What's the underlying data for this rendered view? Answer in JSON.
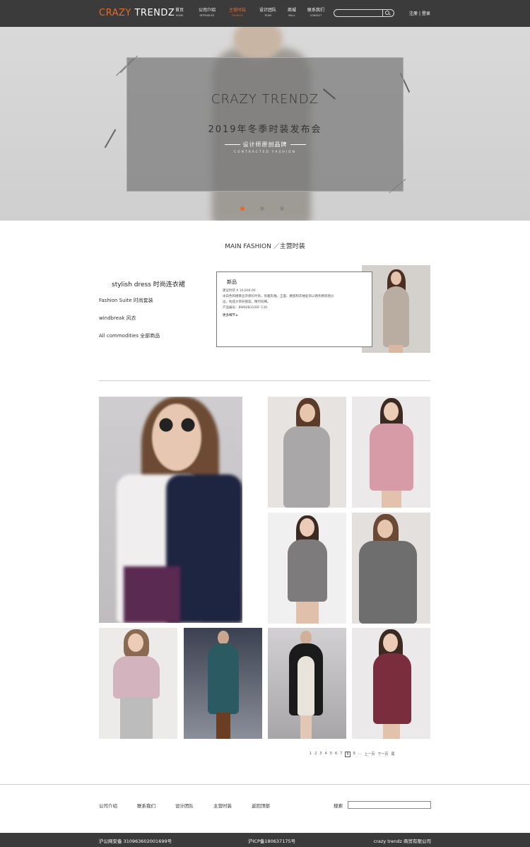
{
  "header": {
    "logo_a": "CRAZY",
    "logo_b": "TRENDZ",
    "nav": [
      {
        "cn": "首页",
        "en": "HOME"
      },
      {
        "cn": "公司介绍",
        "en": "INTRODUCE"
      },
      {
        "cn": "主营时装",
        "en": "FASHION"
      },
      {
        "cn": "设计团队",
        "en": "TEAM"
      },
      {
        "cn": "商城",
        "en": "MALL"
      },
      {
        "cn": "联系我们",
        "en": "CONTACT"
      }
    ],
    "register": "注册",
    "divider": "|",
    "login": "登录",
    "accent": "#e8692a"
  },
  "hero": {
    "title": "CRAZY TRENDZ",
    "subtitle": "2019年冬季时装发布会",
    "tagline": "设计师原创品牌",
    "tagline_en": "CONTRACTED FASHION",
    "active_slide": 1,
    "slides": 3
  },
  "main": {
    "section_title": "MAIN  FASHION ／主营时装",
    "cat_main": "stylish dress  时尚连衣裙",
    "cats": [
      "Fashion Suite   时尚套装",
      "windbreak  风衣",
      "All commodities   全部商品"
    ],
    "product": {
      "title": "新品",
      "price": "建议时装    ¥ 10,500.00",
      "desc1": "米白色和撞黄丝开襟衫时尚，优雅乳釉。正面、腰部和衣袖处饰以网条精装图分",
      "desc2": "边，构成大率形图案。精内较细。",
      "code": "产品编号：BW60B3106F-130",
      "more": "更多细节 ▸"
    }
  },
  "pager": [
    "1",
    "2",
    "3",
    "4",
    "5",
    "6",
    "7",
    "8",
    "9",
    "...",
    "上一页",
    "下一页",
    "尾"
  ],
  "footer": {
    "nav": [
      "公司介绍",
      "联系我们",
      "设计团队",
      "主营时装",
      "返回顶部"
    ],
    "search_label": "搜索",
    "icp1": "沪公网安备 310963602001699号",
    "icp2": "沪ICP备180637175号",
    "company": "crazy trendz 商贸有限公司"
  }
}
